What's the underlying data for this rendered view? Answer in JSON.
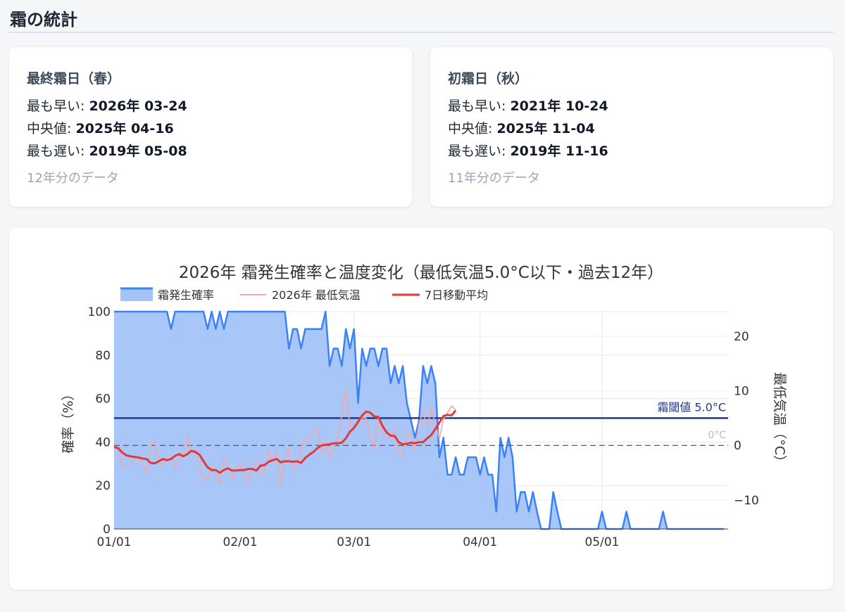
{
  "section": {
    "title": "霜の統計"
  },
  "spring": {
    "heading": "最終霜日（春）",
    "earliest_label": "最も早い: ",
    "earliest_value": "2026年 03-24",
    "median_label": "中央値: ",
    "median_value": "2025年 04-16",
    "latest_label": "最も遅い: ",
    "latest_value": "2019年 05-08",
    "data_note": "12年分のデータ"
  },
  "autumn": {
    "heading": "初霜日（秋）",
    "earliest_label": "最も早い: ",
    "earliest_value": "2021年 10-24",
    "median_label": "中央値: ",
    "median_value": "2025年 11-04",
    "latest_label": "最も遅い: ",
    "latest_value": "2019年 11-16",
    "data_note": "11年分のデータ"
  },
  "colors": {
    "probability_line": "#3b82f6",
    "probability_fill": "#a3c3f7",
    "temp_line": "#f4a7aa",
    "moving_avg": "#e0393e",
    "threshold": "#1e3a8a",
    "zero_line": "#555555"
  },
  "chart_data": {
    "type": "line",
    "title": "2026年 霜発生確率と温度変化（最低気温5.0°C以下・過去12年）",
    "ylabel": "確率（%）",
    "y2label": "最低気温（°C）",
    "ylim": [
      0,
      100
    ],
    "y2lim": [
      -15.3,
      24.5
    ],
    "xlim": [
      "2026-01-01",
      "2026-06-01"
    ],
    "x_ticks": [
      "01/01",
      "02/01",
      "03/01",
      "04/01",
      "05/01"
    ],
    "y_ticks": [
      "0",
      "20",
      "40",
      "60",
      "80",
      "100"
    ],
    "y2_ticks": [
      "−10",
      "0",
      "10",
      "20"
    ],
    "legend": [
      "霜発生確率",
      "2026年 最低気温",
      "7日移動平均"
    ],
    "legend_position": "top-left",
    "threshold": {
      "value": 5.0,
      "label": "霜閾値 5.0°C"
    },
    "zero_line": {
      "value": 0,
      "label": "0°C"
    },
    "grid": true,
    "series": [
      {
        "name": "霜発生確率",
        "axis": "left",
        "x": [
          1,
          14,
          15,
          16,
          23,
          24,
          25,
          26,
          27,
          28,
          29,
          30,
          43,
          44,
          45,
          46,
          47,
          48,
          49,
          52,
          53,
          54,
          55,
          56,
          57,
          58,
          59,
          60,
          61,
          62,
          63,
          64,
          65,
          66,
          67,
          68,
          69,
          70,
          71,
          72,
          73,
          74,
          75,
          76,
          77,
          78,
          79,
          80,
          81,
          82,
          83,
          84,
          85,
          86,
          87,
          88,
          89,
          90,
          91,
          92,
          93,
          94,
          95,
          96,
          97,
          98,
          99,
          100,
          101,
          102,
          103,
          104,
          105,
          106,
          107,
          108,
          109,
          110,
          111,
          112,
          113,
          118,
          119,
          120,
          121,
          122,
          126,
          127,
          128,
          135,
          136,
          137,
          151
        ],
        "y": [
          100,
          100,
          92,
          100,
          100,
          92,
          100,
          92,
          100,
          92,
          100,
          100,
          100,
          83,
          92,
          92,
          83,
          92,
          92,
          92,
          100,
          75,
          83,
          83,
          75,
          92,
          83,
          92,
          58,
          83,
          75,
          83,
          83,
          75,
          83,
          83,
          67,
          75,
          67,
          75,
          58,
          50,
          42,
          50,
          75,
          67,
          75,
          67,
          33,
          42,
          25,
          25,
          33,
          25,
          25,
          33,
          33,
          33,
          25,
          33,
          25,
          25,
          8,
          42,
          33,
          42,
          33,
          8,
          17,
          17,
          8,
          17,
          8,
          0,
          0,
          0,
          17,
          8,
          0,
          0,
          0,
          0,
          0,
          0,
          8,
          0,
          0,
          8,
          0,
          0,
          8,
          0,
          0
        ]
      },
      {
        "name": "2026年 最低気温",
        "axis": "right",
        "x": [
          1,
          2,
          3,
          4,
          5,
          6,
          7,
          8,
          9,
          10,
          11,
          12,
          13,
          14,
          15,
          16,
          17,
          18,
          19,
          20,
          21,
          22,
          23,
          24,
          25,
          26,
          27,
          28,
          29,
          30,
          31,
          32,
          33,
          34,
          35,
          36,
          37,
          38,
          39,
          40,
          41,
          42,
          43,
          44,
          45,
          46,
          47,
          48,
          49,
          50,
          51,
          52,
          53,
          54,
          55,
          56,
          57,
          58,
          59,
          60,
          61,
          62,
          63,
          64,
          65,
          66,
          67,
          68,
          69,
          70,
          71,
          72,
          73,
          74,
          75,
          76,
          77,
          78,
          79,
          80,
          81,
          82,
          83,
          84,
          85
        ],
        "y": [
          -0.3,
          -0.5,
          -3.6,
          -3.8,
          -3.4,
          -2.4,
          -2.2,
          -3.2,
          -5.0,
          -0.2,
          0.8,
          -3.0,
          -3.6,
          -2.8,
          -2.0,
          -4.2,
          -2.5,
          -1.8,
          1.8,
          -1.2,
          -0.8,
          -3.4,
          -6.5,
          -6.0,
          -3.8,
          -5.2,
          -7.0,
          -2.4,
          -3.5,
          -6.2,
          -4.3,
          -3.3,
          -5.4,
          -6.8,
          -3.8,
          -2.8,
          -5.6,
          -5.2,
          -0.9,
          -3.0,
          -1.0,
          -7.2,
          -2.7,
          -0.6,
          -4.6,
          -3.0,
          -0.4,
          1.1,
          1.4,
          2.5,
          3.2,
          -1.5,
          0.8,
          -2.3,
          -0.5,
          1.5,
          5.5,
          10.2,
          3.5,
          3.8,
          3.8,
          5.1,
          5.0,
          1.5,
          -0.8,
          5.6,
          2.1,
          1.3,
          1.2,
          2.7,
          -1.0,
          -2.0,
          2.7,
          2.1,
          -1.0,
          4.1,
          6.2,
          3.2,
          7.1,
          3.8,
          1.3,
          4.8,
          6.0,
          7.2,
          6.5
        ]
      },
      {
        "name": "7日移動平均",
        "axis": "right",
        "x": [
          1,
          2,
          3,
          4,
          5,
          6,
          7,
          8,
          9,
          10,
          11,
          12,
          13,
          14,
          15,
          16,
          17,
          18,
          19,
          20,
          21,
          22,
          23,
          24,
          25,
          26,
          27,
          28,
          29,
          30,
          31,
          32,
          33,
          34,
          35,
          36,
          37,
          38,
          39,
          40,
          41,
          42,
          43,
          44,
          45,
          46,
          47,
          48,
          49,
          50,
          51,
          52,
          53,
          54,
          55,
          56,
          57,
          58,
          59,
          60,
          61,
          62,
          63,
          64,
          65,
          66,
          67,
          68,
          69,
          70,
          71,
          72,
          73,
          74,
          75,
          76,
          77,
          78,
          79,
          80,
          81,
          82,
          83,
          84,
          85
        ],
        "y": [
          -0.3,
          -0.5,
          -1.3,
          -1.8,
          -2.0,
          -2.1,
          -2.2,
          -2.4,
          -2.5,
          -3.2,
          -3.3,
          -2.9,
          -2.5,
          -2.7,
          -2.5,
          -1.9,
          -1.6,
          -2.0,
          -1.6,
          -1.0,
          -1.2,
          -1.7,
          -2.9,
          -4.0,
          -4.5,
          -4.5,
          -5.0,
          -4.5,
          -4.2,
          -4.6,
          -4.6,
          -4.5,
          -4.5,
          -4.3,
          -4.3,
          -4.6,
          -3.7,
          -3.6,
          -3.0,
          -2.7,
          -2.5,
          -3.1,
          -2.9,
          -2.9,
          -3.0,
          -2.9,
          -3.2,
          -2.3,
          -1.7,
          -1.2,
          -0.5,
          -0.0,
          0.1,
          0.2,
          0.4,
          0.4,
          0.5,
          1.3,
          2.5,
          3.2,
          4.3,
          5.5,
          6.2,
          6.0,
          5.3,
          5.2,
          3.6,
          2.4,
          1.8,
          1.7,
          0.6,
          0.2,
          0.3,
          0.5,
          0.4,
          0.6,
          0.6,
          1.3,
          1.9,
          3.0,
          4.2,
          5.4,
          5.6,
          5.5,
          6.4
        ]
      }
    ]
  }
}
